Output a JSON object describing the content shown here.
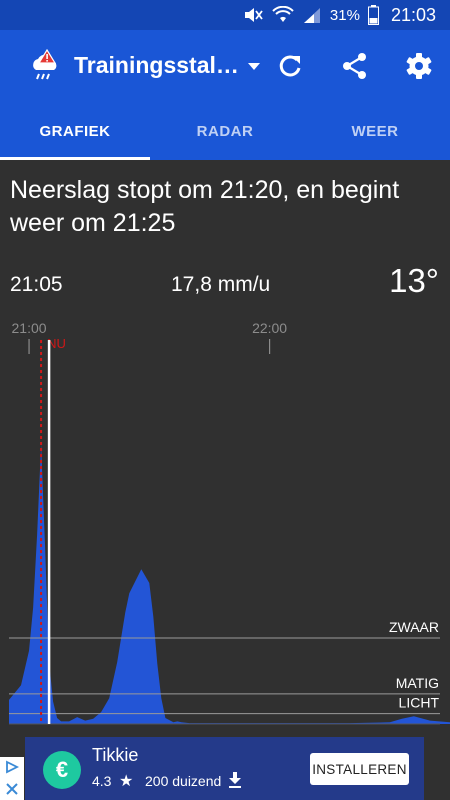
{
  "status_bar": {
    "battery_percent": "31%",
    "time": "21:03",
    "icons": [
      "mute-icon",
      "wifi-icon",
      "signal-icon",
      "battery-icon"
    ]
  },
  "app_bar": {
    "title": "Trainingsstal…",
    "icons": [
      "weather-warning-logo-icon",
      "dropdown-icon",
      "refresh-icon",
      "share-icon",
      "settings-icon"
    ]
  },
  "tabs": [
    {
      "label": "GRAFIEK",
      "active": true
    },
    {
      "label": "RADAR",
      "active": false
    },
    {
      "label": "WEER",
      "active": false
    }
  ],
  "forecast": {
    "message": "Neerslag stopt om 21:20, en begint weer om 21:25",
    "time": "21:05",
    "rate": "17,8 mm/u",
    "temperature": "13°"
  },
  "chart_data": {
    "type": "area",
    "x_start": "20:55",
    "x_end": "22:45",
    "x_ticks": [
      "21:00",
      "22:00"
    ],
    "now_label": "NU",
    "now_time": "21:03",
    "cursor_time": "21:05",
    "intensity_levels": [
      "ZWAAR",
      "MATIG",
      "LICHT"
    ],
    "series": [
      {
        "x": [
          "20:55",
          "20:58",
          "21:00",
          "21:01",
          "21:02",
          "21:03",
          "21:04",
          "21:05",
          "21:06",
          "21:07",
          "21:08",
          "21:10",
          "21:12",
          "21:14",
          "21:16",
          "21:18",
          "21:20",
          "21:22",
          "21:24",
          "21:25",
          "21:28",
          "21:30",
          "21:31",
          "21:32",
          "21:33",
          "21:34",
          "21:36",
          "21:37",
          "21:38",
          "21:40",
          "21:45",
          "21:50",
          "21:55",
          "22:00",
          "22:10",
          "22:20",
          "22:30",
          "22:33",
          "22:36",
          "22:40",
          "22:45"
        ],
        "y": [
          0.28,
          0.45,
          0.85,
          1.35,
          2.2,
          3.25,
          2.05,
          0.72,
          0.26,
          0.07,
          0.03,
          0.03,
          0.08,
          0.04,
          0.06,
          0.14,
          0.3,
          0.72,
          1.3,
          1.52,
          1.8,
          1.64,
          1.25,
          0.7,
          0.3,
          0.07,
          0.02,
          0.03,
          0.02,
          0.01,
          0.01,
          0.01,
          0.01,
          0.01,
          0.01,
          0.01,
          0.02,
          0.06,
          0.09,
          0.04,
          0.02
        ]
      }
    ],
    "colors": {
      "area": "#2355d6",
      "now_line": "#d01818",
      "cursor": "#ffffff",
      "level_lines": "#9a9a9a"
    }
  },
  "ad": {
    "app_name": "Tikkie",
    "rating": "4.3",
    "downloads": "200 duizend",
    "install_label": "INSTALLEREN",
    "app_icon_glyph": "€",
    "icons": [
      "adchoices-icon",
      "ad-close-icon",
      "star-icon",
      "download-icon"
    ]
  },
  "colors": {
    "status_bar": "#1446b4",
    "app_bar": "#1a56d6",
    "background": "#303030",
    "ad_background": "#243a8a",
    "ad_icon": "#1ec9a0"
  }
}
